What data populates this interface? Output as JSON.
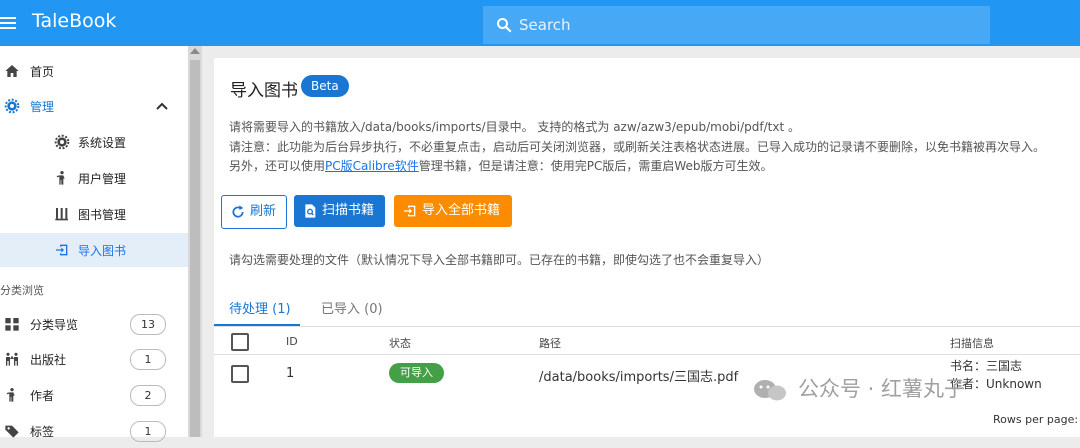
{
  "app": {
    "title": "TaleBook"
  },
  "search": {
    "placeholder": "Search"
  },
  "sidebar": {
    "home": "首页",
    "admin": "管理",
    "admin_items": [
      "系统设置",
      "用户管理",
      "图书管理",
      "导入图书"
    ],
    "section": "分类浏览",
    "browse": [
      {
        "label": "分类导览",
        "count": "13"
      },
      {
        "label": "出版社",
        "count": "1"
      },
      {
        "label": "作者",
        "count": "2"
      },
      {
        "label": "标签",
        "count": "1"
      }
    ]
  },
  "page": {
    "title": "导入图书",
    "badge": "Beta",
    "desc1": "请将需要导入的书籍放入/data/books/imports/目录中。 支持的格式为 azw/azw3/epub/mobi/pdf/txt 。",
    "desc2": "请注意：此功能为后台异步执行，不必重复点击，启动后可关闭浏览器，或刷新关注表格状态进展。已导入成功的记录请不要删除，以免书籍被再次导入。",
    "desc3_pre": "另外，还可以使用",
    "desc3_link": "PC版Calibre软件",
    "desc3_post": "管理书籍，但是请注意：使用完PC版后，需重启Web版方可生效。",
    "buttons": {
      "refresh": "刷新",
      "scan": "扫描书籍",
      "import_all": "导入全部书籍"
    },
    "hint": "请勾选需要处理的文件（默认情况下导入全部书籍即可。已存在的书籍，即使勾选了也不会重复导入）",
    "tabs": [
      "待处理 (1)",
      "已导入 (0)"
    ],
    "table": {
      "headers": [
        "ID",
        "状态",
        "路径",
        "扫描信息"
      ],
      "rows": [
        {
          "id": "1",
          "status": "可导入",
          "path": "/data/books/imports/三国志.pdf",
          "info1": "书名：三国志",
          "info2": "作者：Unknown"
        }
      ]
    },
    "rows_per_page": "Rows per page:"
  },
  "watermark": "公众号 · 红薯丸子",
  "colors": {
    "primary": "#2196f3",
    "accent": "#1976d2",
    "orange": "#fb8c00",
    "success": "#43a047"
  }
}
